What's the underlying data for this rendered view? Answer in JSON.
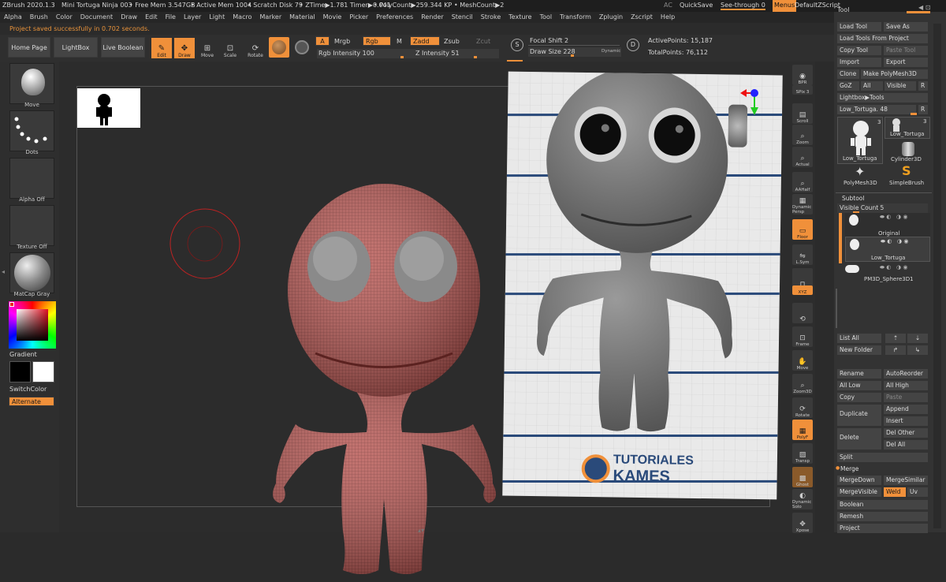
{
  "titlebar": {
    "app": "ZBrush 2020.1.3",
    "doc": "Mini Tortuga Ninja 003",
    "free_mem": "• Free Mem 3.547GB",
    "active_mem": "• Active Mem 1004",
    "scratch": "• Scratch Disk 79",
    "ztime": "• ZTime▶1.781 Timer▶0.041",
    "polycount": "• PolyCount▶259.344 KP",
    "meshcount": "• MeshCount▶2",
    "ac": "AC",
    "quicksave": "QuickSave",
    "seethrough": "See-through  0",
    "menus": "Menus",
    "defaultzscript": "DefaultZScript"
  },
  "menu": [
    "Alpha",
    "Brush",
    "Color",
    "Document",
    "Draw",
    "Edit",
    "File",
    "Layer",
    "Light",
    "Macro",
    "Marker",
    "Material",
    "Movie",
    "Picker",
    "Preferences",
    "Render",
    "Stencil",
    "Stroke",
    "Texture",
    "Tool",
    "Transform",
    "Zplugin",
    "Zscript",
    "Help"
  ],
  "status": "Project saved successfully in 0.702 seconds.",
  "shelf": {
    "home": "Home Page",
    "lightbox": "LightBox",
    "liveboolean": "Live Boolean",
    "edit": "Edit",
    "draw": "Draw",
    "move": "Move",
    "scale": "Scale",
    "rotate": "Rotate",
    "a": "A",
    "mrgb": "Mrgb",
    "rgb": "Rgb",
    "m": "M",
    "zadd": "Zadd",
    "zsub": "Zsub",
    "zcut": "Zcut",
    "rgb_intensity": "Rgb Intensity 100",
    "z_intensity": "Z Intensity 51",
    "focal_shift": "Focal Shift 2",
    "draw_size": "Draw Size 228",
    "dynamic": "Dynamic",
    "active_points": "ActivePoints: 15,187",
    "total_points": "TotalPoints: 76,112"
  },
  "left": {
    "move": "Move",
    "dots": "Dots",
    "alpha_off": "Alpha Off",
    "texture_off": "Texture Off",
    "matcap": "MatCap Gray",
    "gradient": "Gradient",
    "switchcolor": "SwitchColor",
    "alternate": "Alternate"
  },
  "right_shelf": [
    "BPR",
    "SPix 3",
    "Scroll",
    "Zoom",
    "Actual",
    "AAHalf",
    "Dynamic Persp",
    "Floor",
    "L.Sym",
    "",
    "XYZ",
    "",
    "Frame",
    "Move",
    "Zoom3D",
    "Rotate",
    "PolyF",
    "Transp",
    "Ghost",
    "Dynamic Solo",
    "Xpose"
  ],
  "panel": {
    "load_tool": "Load Tool",
    "save_as": "Save As",
    "load_from_project": "Load Tools From Project",
    "copy_tool": "Copy Tool",
    "paste_tool": "Paste Tool",
    "import": "Import",
    "export": "Export",
    "clone": "Clone",
    "make_polymesh": "Make PolyMesh3D",
    "goz": "GoZ",
    "all": "All",
    "visible": "Visible",
    "r": "R",
    "lightbox_tools": "Lightbox▶Tools",
    "low_tortuga": "Low_Tortuga. 48",
    "r2": "R",
    "thumb_low": "Low_Tortuga",
    "thumb_low2": "Low_Tortuga",
    "thumb_cyl": "Cylinder3D",
    "thumb_poly": "PolyMesh3D",
    "thumb_simple": "SimpleBrush",
    "badge3": "3",
    "badge3b": "3",
    "subtool": "Subtool",
    "visible_count": "Visible Count 5",
    "st_original": "Original",
    "st_low": "Low_Tortuga",
    "st_sphere": "PM3D_Sphere3D1",
    "list_all": "List All",
    "new_folder": "New Folder",
    "rename": "Rename",
    "autoreorder": "AutoReorder",
    "all_low": "All Low",
    "all_high": "All High",
    "copy": "Copy",
    "paste": "Paste",
    "duplicate": "Duplicate",
    "append": "Append",
    "insert": "Insert",
    "delete": "Delete",
    "del_other": "Del Other",
    "del_all": "Del All",
    "split": "Split",
    "merge": "Merge",
    "mergedown": "MergeDown",
    "mergesimilar": "MergeSimilar",
    "mergevisible": "MergeVisible",
    "weld": "Weld",
    "uv": "Uv",
    "boolean": "Boolean",
    "remesh": "Remesh",
    "project": "Project"
  },
  "reference": {
    "logo_line1": "TUTORIALES",
    "logo_line2": "KAMES"
  },
  "colors": {
    "accent": "#f0903a",
    "mesh": "#b85a56",
    "reference_bg": "#e8e8e8"
  }
}
